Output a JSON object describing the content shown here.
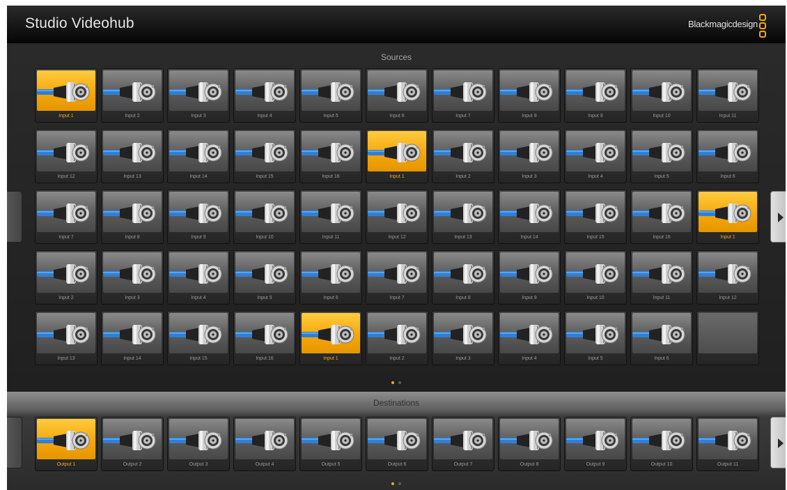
{
  "app": {
    "title": "Studio Videohub",
    "brand": "Blackmagicdesign"
  },
  "sources": {
    "label": "Sources",
    "tiles": [
      {
        "label": "Input 1",
        "selected": true
      },
      {
        "label": "Input 2"
      },
      {
        "label": "Input 3"
      },
      {
        "label": "Input 4"
      },
      {
        "label": "Input 5"
      },
      {
        "label": "Input 6"
      },
      {
        "label": "Input 7"
      },
      {
        "label": "Input 8"
      },
      {
        "label": "Input 9"
      },
      {
        "label": "Input 10"
      },
      {
        "label": "Input 11"
      },
      {
        "label": "Input 12"
      },
      {
        "label": "Input 13"
      },
      {
        "label": "Input 14"
      },
      {
        "label": "Input 15"
      },
      {
        "label": "Input 16"
      },
      {
        "label": "Input 1",
        "selected": true
      },
      {
        "label": "Input 2"
      },
      {
        "label": "Input 3"
      },
      {
        "label": "Input 4"
      },
      {
        "label": "Input 5"
      },
      {
        "label": "Input 6"
      },
      {
        "label": "Input 7"
      },
      {
        "label": "Input 8"
      },
      {
        "label": "Input 9"
      },
      {
        "label": "Input 10"
      },
      {
        "label": "Input 11"
      },
      {
        "label": "Input 12"
      },
      {
        "label": "Input 13"
      },
      {
        "label": "Input 14"
      },
      {
        "label": "Input 15"
      },
      {
        "label": "Input 16"
      },
      {
        "label": "Input 1",
        "selected": true
      },
      {
        "label": "Input 2"
      },
      {
        "label": "Input 3"
      },
      {
        "label": "Input 4"
      },
      {
        "label": "Input 5"
      },
      {
        "label": "Input 6"
      },
      {
        "label": "Input 7"
      },
      {
        "label": "Input 8"
      },
      {
        "label": "Input 9"
      },
      {
        "label": "Input 10"
      },
      {
        "label": "Input 11"
      },
      {
        "label": "Input 12"
      },
      {
        "label": "Input 13"
      },
      {
        "label": "Input 14"
      },
      {
        "label": "Input 15"
      },
      {
        "label": "Input 16"
      },
      {
        "label": "Input 1",
        "selected": true
      },
      {
        "label": "Input 2"
      },
      {
        "label": "Input 3"
      },
      {
        "label": "Input 4"
      },
      {
        "label": "Input 5"
      },
      {
        "label": "Input 6"
      },
      {
        "label": "",
        "empty": true
      }
    ],
    "page_count": 2,
    "active_page": 1,
    "next_icon": "chevron-right-icon"
  },
  "destinations": {
    "label": "Destinations",
    "tiles": [
      {
        "label": "Output 1",
        "selected": true
      },
      {
        "label": "Output 2"
      },
      {
        "label": "Output 3"
      },
      {
        "label": "Output 4"
      },
      {
        "label": "Output 5"
      },
      {
        "label": "Output 6"
      },
      {
        "label": "Output 7"
      },
      {
        "label": "Output 8"
      },
      {
        "label": "Output 9"
      },
      {
        "label": "Output 10"
      },
      {
        "label": "Output 11"
      }
    ],
    "page_count": 2,
    "active_page": 1,
    "next_icon": "chevron-right-icon"
  },
  "colors": {
    "accent": "#f5a623",
    "brand_logo": "#f5a810"
  },
  "tile_icon": "bnc-connector-icon"
}
